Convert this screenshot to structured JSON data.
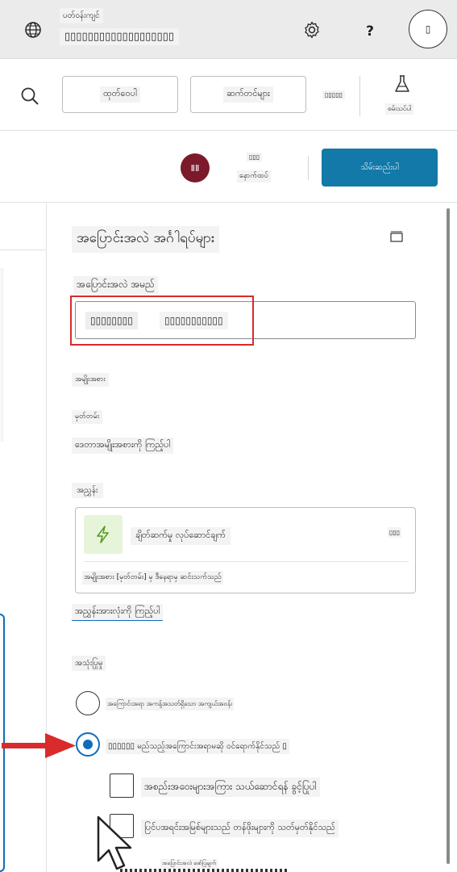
{
  "header": {
    "env_label": "ပတ်ဝန်းကျင်",
    "env_name": "▯▯▯▯▯▯▯▯▯▯▯▯▯▯▯▯▯▯▯",
    "help_label": "?",
    "avatar_label": "▯"
  },
  "toolbar": {
    "publish_label": "ထုတ်ဝေပါ",
    "settings_label": "ဆက်တင်များ",
    "more_label": "▯▯▯▯▯",
    "test_label": "စမ်းသပ်ပါ"
  },
  "commandbar": {
    "user_initials": "ⅡⅡ",
    "user_caption_top": "▯▯▯",
    "user_caption": "နောက်ထပ်",
    "save_label": "သိမ်းဆည်းပါ"
  },
  "panel": {
    "title": "အပြောင်းအလဲ အင်္ဂါရပ်များ",
    "name_label": "အပြောင်းအလဲ အမည်",
    "name_value_part1": "▯▯▯▯▯▯▯▯",
    "name_value_part2": "▯▯▯▯▯▯▯▯▯▯▯",
    "type_label": "အမျိုးအစား",
    "desc_label": "မှတ်တမ်း",
    "see_types_link": "ဒေတာအမျိုးအစားကို ကြည့်ပါ",
    "trigger_label": "အညွှန်း",
    "trigger_card_title": "ချိတ်ဆက်မှု လုပ်ဆောင်ချက်",
    "trigger_card_more": "▯▯▯",
    "trigger_card_desc": "အမျိုးအစား [မှတ်တမ်း] မှ ဒီနေရာမှ ဆင်းသက်သည်",
    "see_all_link": "အညွှန်းအားလုံးကို ကြည့်ပါ",
    "usage_label": "အသုံးပြုမှု",
    "option1_label": "အကြောင်းအရာ အကန့်အသတ်ရှိသော အကျယ်အဝန်း",
    "option2_label": "▯▯▯▯▯▯ မည်သည့်အကြောင်းအရာမဆို ဝင်ရောက်နိုင်သည် ▯",
    "check1_label": "အစည်းအဝေးများအကြား သယ်ဆောင်ရန် ခွင့်ပြုပါ",
    "check2_label": "ပြင်ပအရင်းအမြစ်များသည် တန်ဖိုးများကို သတ်မှတ်နိုင်သည်",
    "footer_label": "အပြောင်းအလဲ ဖော်ပြချက်"
  },
  "colors": {
    "accent": "#0f6cbd",
    "save_button": "#1279a8",
    "avatar_bg": "#7a1a2a",
    "highlight_red": "#d92b2b",
    "trigger_icon_bg": "#e6f4d9",
    "trigger_icon_fg": "#4e9a1a"
  }
}
